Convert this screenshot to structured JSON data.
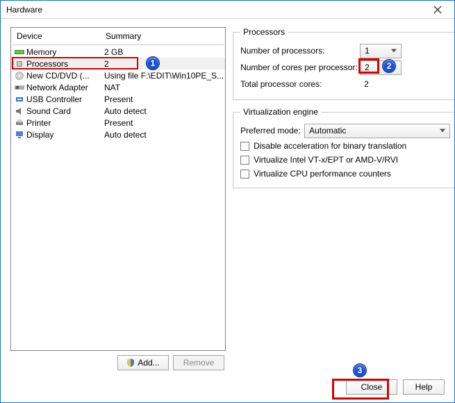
{
  "window": {
    "title": "Hardware"
  },
  "columns": {
    "device": "Device",
    "summary": "Summary"
  },
  "devices": [
    {
      "name": "Memory",
      "summary": "2 GB",
      "icon": "memory"
    },
    {
      "name": "Processors",
      "summary": "2",
      "icon": "cpu",
      "selected": true
    },
    {
      "name": "New CD/DVD (...",
      "summary": "Using file F:\\EDIT\\Win10PE_S...",
      "icon": "disc"
    },
    {
      "name": "Network Adapter",
      "summary": "NAT",
      "icon": "nic"
    },
    {
      "name": "USB Controller",
      "summary": "Present",
      "icon": "usb"
    },
    {
      "name": "Sound Card",
      "summary": "Auto detect",
      "icon": "sound"
    },
    {
      "name": "Printer",
      "summary": "Present",
      "icon": "printer"
    },
    {
      "name": "Display",
      "summary": "Auto detect",
      "icon": "display"
    }
  ],
  "buttons": {
    "add": "Add...",
    "remove": "Remove",
    "close": "Close",
    "help": "Help"
  },
  "processors": {
    "legend": "Processors",
    "num_label": "Number of processors:",
    "num_value": "1",
    "cores_label": "Number of cores per processor:",
    "cores_value": "2",
    "total_label": "Total processor cores:",
    "total_value": "2"
  },
  "virt": {
    "legend": "Virtualization engine",
    "mode_label": "Preferred mode:",
    "mode_value": "Automatic",
    "opt1": "Disable acceleration for binary translation",
    "opt2": "Virtualize Intel VT-x/EPT or AMD-V/RVI",
    "opt3": "Virtualize CPU performance counters"
  },
  "callouts": {
    "c1": "1",
    "c2": "2",
    "c3": "3"
  }
}
